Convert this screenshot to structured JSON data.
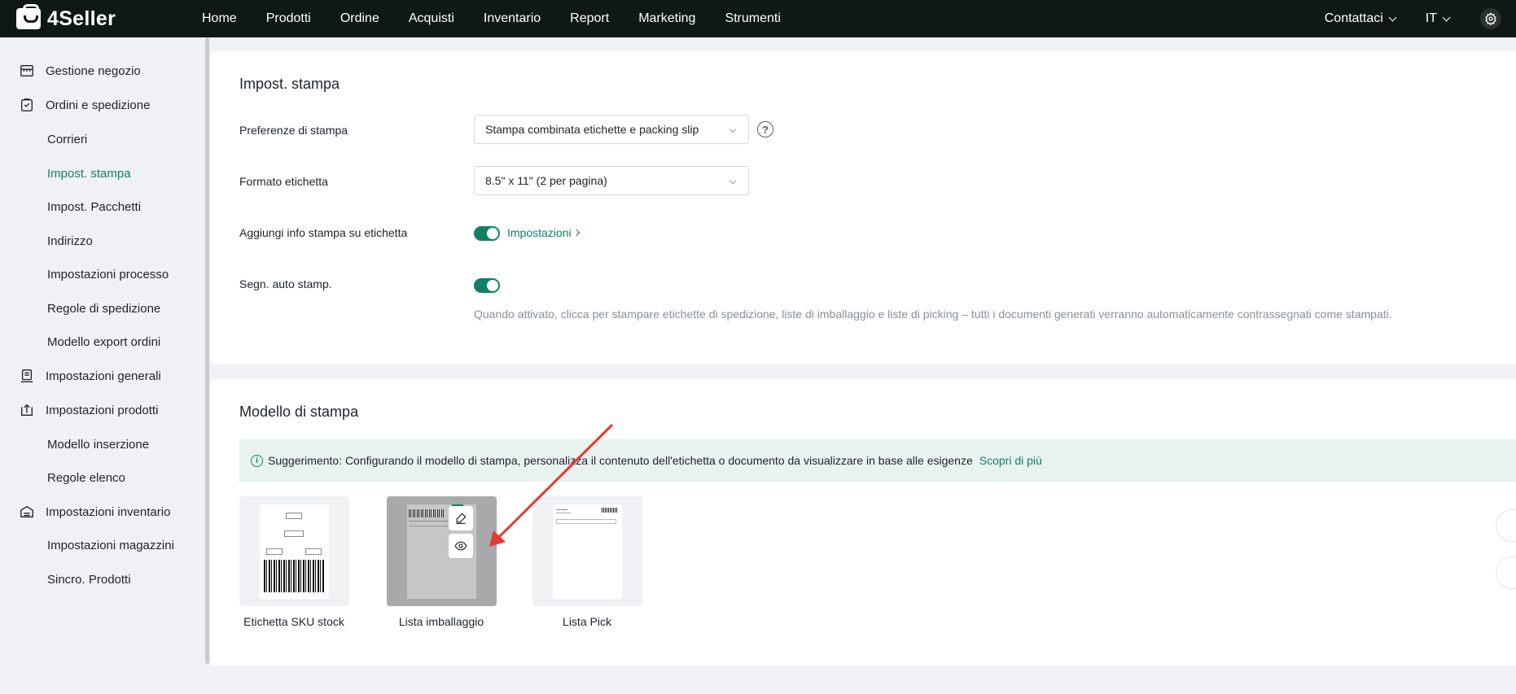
{
  "app": {
    "logo": "4Seller"
  },
  "topnav": {
    "items": [
      "Home",
      "Prodotti",
      "Ordine",
      "Acquisti",
      "Inventario",
      "Report",
      "Marketing",
      "Strumenti"
    ],
    "contact": "Contattaci",
    "lang": "IT"
  },
  "sidebar": {
    "items": [
      {
        "label": "Gestione negozio",
        "type": "group",
        "icon": "store-icon"
      },
      {
        "label": "Ordini e spedizione",
        "type": "group",
        "icon": "order-icon"
      },
      {
        "label": "Corrieri",
        "type": "sub"
      },
      {
        "label": "Impost. stampa",
        "type": "sub",
        "active": true
      },
      {
        "label": "Impost. Pacchetti",
        "type": "sub"
      },
      {
        "label": "Indirizzo",
        "type": "sub"
      },
      {
        "label": "Impostazioni processo",
        "type": "sub"
      },
      {
        "label": "Regole di spedizione",
        "type": "sub"
      },
      {
        "label": "Modello export ordini",
        "type": "sub"
      },
      {
        "label": "Impostazioni generali",
        "type": "group",
        "icon": "settings-doc-icon"
      },
      {
        "label": "Impostazioni prodotti",
        "type": "group",
        "icon": "upload-box-icon"
      },
      {
        "label": "Modello inserzione",
        "type": "sub"
      },
      {
        "label": "Regole elenco",
        "type": "sub"
      },
      {
        "label": "Impostazioni inventario",
        "type": "group",
        "icon": "warehouse-icon"
      },
      {
        "label": "Impostazioni magazzini",
        "type": "sub"
      },
      {
        "label": "Sincro. Prodotti",
        "type": "sub"
      }
    ]
  },
  "print_settings": {
    "title": "Impost. stampa",
    "pref_label": "Preferenze di stampa",
    "pref_value": "Stampa combinata etichette e packing slip",
    "format_label": "Formato etichetta",
    "format_value": "8.5\" x 11\" (2 per pagina)",
    "info_label": "Aggiungi info stampa su etichetta",
    "info_link": "Impostazioni",
    "auto_label": "Segn. auto stamp.",
    "auto_hint": "Quando attivato, clicca per stampare etichette di spedizione, liste di imballaggio e liste di picking – tutti i documenti generati verranno automaticamente contrassegnati come stampati."
  },
  "templates": {
    "title": "Modello di stampa",
    "tip": "Suggerimento: Configurando il modello di stampa, personalizza il contenuto dell'etichetta o documento da visualizzare in base alle esigenze",
    "tip_link": "Scopri di più",
    "items": [
      {
        "label": "Etichetta SKU stock"
      },
      {
        "label": "Lista imballaggio"
      },
      {
        "label": "Lista Pick"
      }
    ]
  },
  "colors": {
    "accent": "#138065",
    "topbar": "#101817",
    "annotation_arrow": "#e53935"
  }
}
